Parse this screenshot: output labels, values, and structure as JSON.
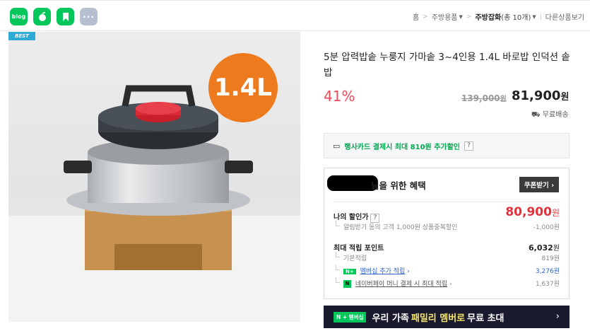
{
  "share": {
    "buttons": [
      {
        "name": "blog-share-icon",
        "label": "blog"
      },
      {
        "name": "naver-share-icon",
        "label": ""
      },
      {
        "name": "bookmark-share-icon",
        "label": ""
      },
      {
        "name": "more-share-icon",
        "label": "···"
      }
    ]
  },
  "breadcrumb": {
    "home": "홈",
    "cat1": "주방용품",
    "cat2": "주방잡화",
    "count": "(총 10개)",
    "other": "다른상품보기"
  },
  "image": {
    "best_label": "BEST",
    "capacity_badge": "1.4L"
  },
  "product": {
    "title": "5분 압력밥솥 누룽지 가마솥 3~4인용 1.4L 바로밥 인덕션 솥밥",
    "discount": "41%",
    "original_price": "139,000",
    "original_unit": "원",
    "price": "81,900",
    "price_unit": "원",
    "shipping": "무료배송"
  },
  "card_promo": {
    "text": "행사카드 결제시 최대 810원 추가할인",
    "help": "?"
  },
  "benefit": {
    "title_suffix": "님을 위한 혜택",
    "coupon_button": "쿠폰받기",
    "my_price_label": "나의 할인가",
    "my_price": "80,900",
    "my_price_unit": "원",
    "alarm_text": "알림받기 동의 고객 1,000원 상품중복할인",
    "alarm_value": "-1,000원",
    "points_label": "최대 적립 포인트",
    "points_total": "6,032",
    "points_unit": "원",
    "base_label": "기본적립",
    "base_value": "819원",
    "membership_label": "멤버십 추가 적립",
    "membership_value": "3,276원",
    "npay_label": "네이버페이 머니 결제 시 최대 적립",
    "npay_value": "1,637원"
  },
  "banner": {
    "badge": "N + 멤버십",
    "text_pre": "우리 가족",
    "text_highlight": "패밀리 멤버로",
    "text_post": "무료 초대"
  },
  "colors": {
    "accent_green": "#03c75a",
    "discount_red": "#f0475a",
    "banner_bg": "#1a1a2e"
  }
}
